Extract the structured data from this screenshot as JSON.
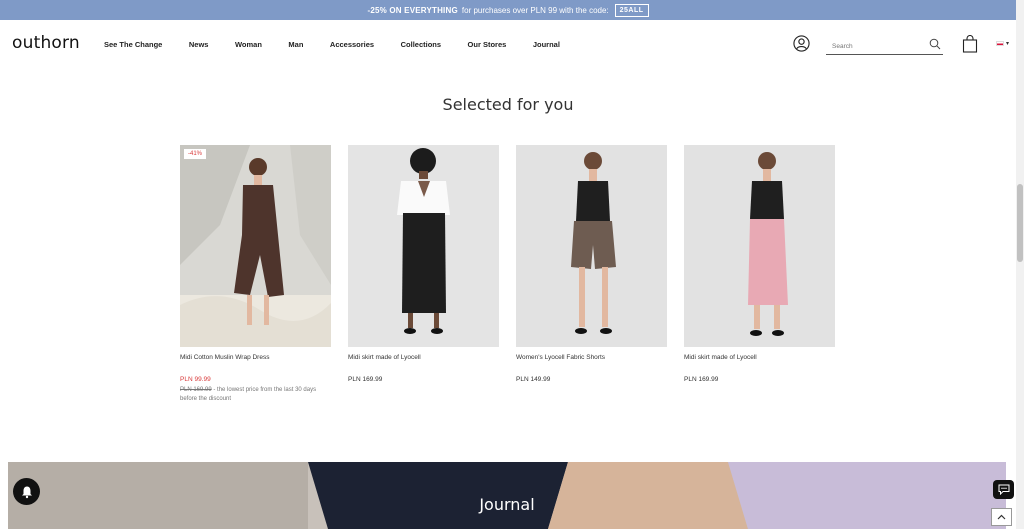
{
  "promo": {
    "highlight": "-25% ON EVERYTHING",
    "text": "for purchases over PLN 99 with the code:",
    "code": "25ALL"
  },
  "header": {
    "logo": "outhorn",
    "nav": [
      "See The Change",
      "News",
      "Woman",
      "Man",
      "Accessories",
      "Collections",
      "Our Stores",
      "Journal"
    ],
    "search_placeholder": "Search",
    "icons": [
      "user-icon",
      "search-icon",
      "bag-icon",
      "flag-pl-icon"
    ]
  },
  "section": {
    "title": "Selected for you"
  },
  "products": [
    {
      "name": "Midi Cotton Muslin Wrap Dress",
      "badge": "-41%",
      "price": "PLN 99.99",
      "old_price": "PLN 169.99",
      "old_note": " - the lowest price from the last 30 days before the discount"
    },
    {
      "name": "Midi skirt made of Lyocell",
      "price": "PLN 169.99"
    },
    {
      "name": "Women's Lyocell Fabric Shorts",
      "price": "PLN 149.99"
    },
    {
      "name": "Midi skirt made of Lyocell",
      "price": "PLN 169.99"
    }
  ],
  "journal": {
    "title": "Journal"
  },
  "colors": {
    "promo_bg": "#7f9ac7",
    "sale_red": "#d83a3a",
    "text": "#222222"
  }
}
